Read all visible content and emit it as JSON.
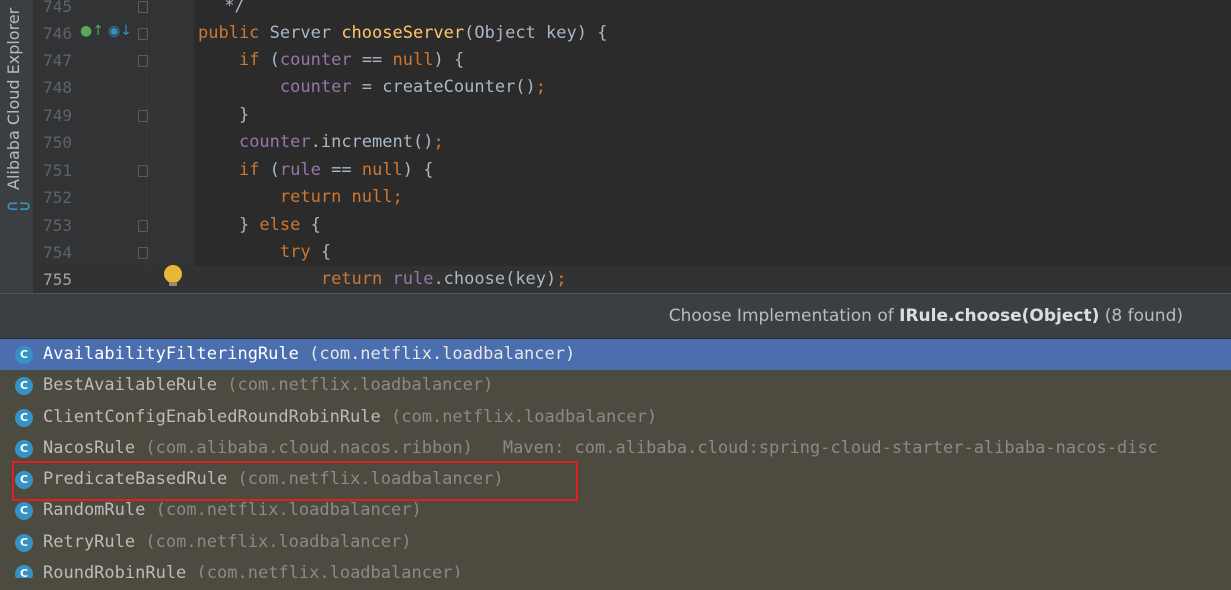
{
  "toolstrip": {
    "label": "Alibaba Cloud Explorer",
    "icon": "alibaba-cloud-icon",
    "icon_glyph": "⊂⊃"
  },
  "editor": {
    "lines": [
      {
        "num": "745",
        "code": " */"
      },
      {
        "num": "746",
        "code": "public Server chooseServer(Object key) {"
      },
      {
        "num": "747",
        "code": "    if (counter == null) {"
      },
      {
        "num": "748",
        "code": "        counter = createCounter();"
      },
      {
        "num": "749",
        "code": "    }"
      },
      {
        "num": "750",
        "code": "    counter.increment();"
      },
      {
        "num": "751",
        "code": "    if (rule == null) {"
      },
      {
        "num": "752",
        "code": "        return null;"
      },
      {
        "num": "753",
        "code": "    } else {"
      },
      {
        "num": "754",
        "code": "        try {"
      },
      {
        "num": "755",
        "code": "            return rule.choose(key);"
      }
    ]
  },
  "popup": {
    "title_prefix": "Choose Implementation of ",
    "title_method": "IRule.choose(Object)",
    "title_suffix": " (8 found)",
    "items": [
      {
        "name": "AvailabilityFilteringRule",
        "package": "(com.netflix.loadbalancer)",
        "extra": ""
      },
      {
        "name": "BestAvailableRule",
        "package": "(com.netflix.loadbalancer)",
        "extra": ""
      },
      {
        "name": "ClientConfigEnabledRoundRobinRule",
        "package": "(com.netflix.loadbalancer)",
        "extra": ""
      },
      {
        "name": "NacosRule",
        "package": "(com.alibaba.cloud.nacos.ribbon)",
        "extra": "Maven: com.alibaba.cloud:spring-cloud-starter-alibaba-nacos-disc"
      },
      {
        "name": "PredicateBasedRule",
        "package": "(com.netflix.loadbalancer)",
        "extra": ""
      },
      {
        "name": "RandomRule",
        "package": "(com.netflix.loadbalancer)",
        "extra": ""
      },
      {
        "name": "RetryRule",
        "package": "(com.netflix.loadbalancer)",
        "extra": ""
      },
      {
        "name": "RoundRobinRule",
        "package": "(com.netflix.loadbalancer)",
        "extra": ""
      }
    ],
    "class_icon_letter": "C"
  },
  "colors": {
    "selection": "#4b6eaf",
    "highlight_border": "#e02020",
    "keyword": "#cc7832",
    "method": "#ffc66d",
    "field": "#9876aa"
  }
}
